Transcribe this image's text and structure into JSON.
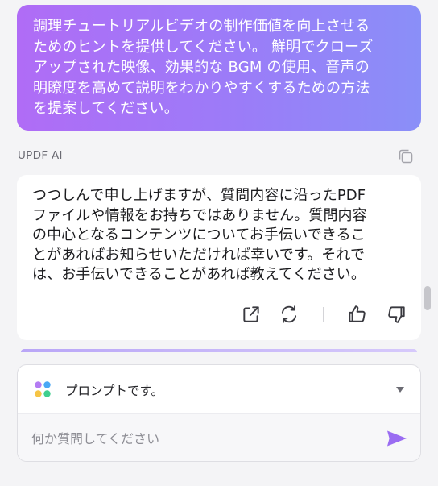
{
  "user_message": {
    "lines": [
      "調理チュートリアルビデオの制作価値を向上させる",
      "ためのヒントを提供してください。 鮮明でクローズ",
      "アップされた映像、効果的な BGM の使用、音声の",
      "明瞭度を高めて説明をわかりやすくするための方法",
      "を提案してください。"
    ]
  },
  "assistant": {
    "label": "UPDF AI",
    "lines": [
      "つつしんで申し上げますが、質問内容に沿ったPDF",
      "ファイルや情報をお持ちではありません。質問内容",
      "の中心となるコンテンツについてお手伝いできるこ",
      "とがあればお知らせいただければ幸いです。それで",
      "は、お手伝いできることがあれば教えてください。"
    ],
    "icons": {
      "copy": "copy-icon",
      "share": "external-link-icon",
      "regenerate": "refresh-icon",
      "like": "thumbs-up-icon",
      "dislike": "thumbs-down-icon"
    }
  },
  "composer": {
    "prompt_label": "プロンプトです。",
    "placeholder": "何か質問してください",
    "value": ""
  },
  "colors": {
    "user_bubble_start": "#b06cf6",
    "user_bubble_end": "#8a8ff8",
    "accent_send": "#9a6cf2",
    "prompt_dot_purple": "#b47cf3",
    "prompt_dot_blue": "#4aa8f5",
    "prompt_dot_yellow": "#f6c445",
    "prompt_dot_green": "#3fcf8e"
  }
}
